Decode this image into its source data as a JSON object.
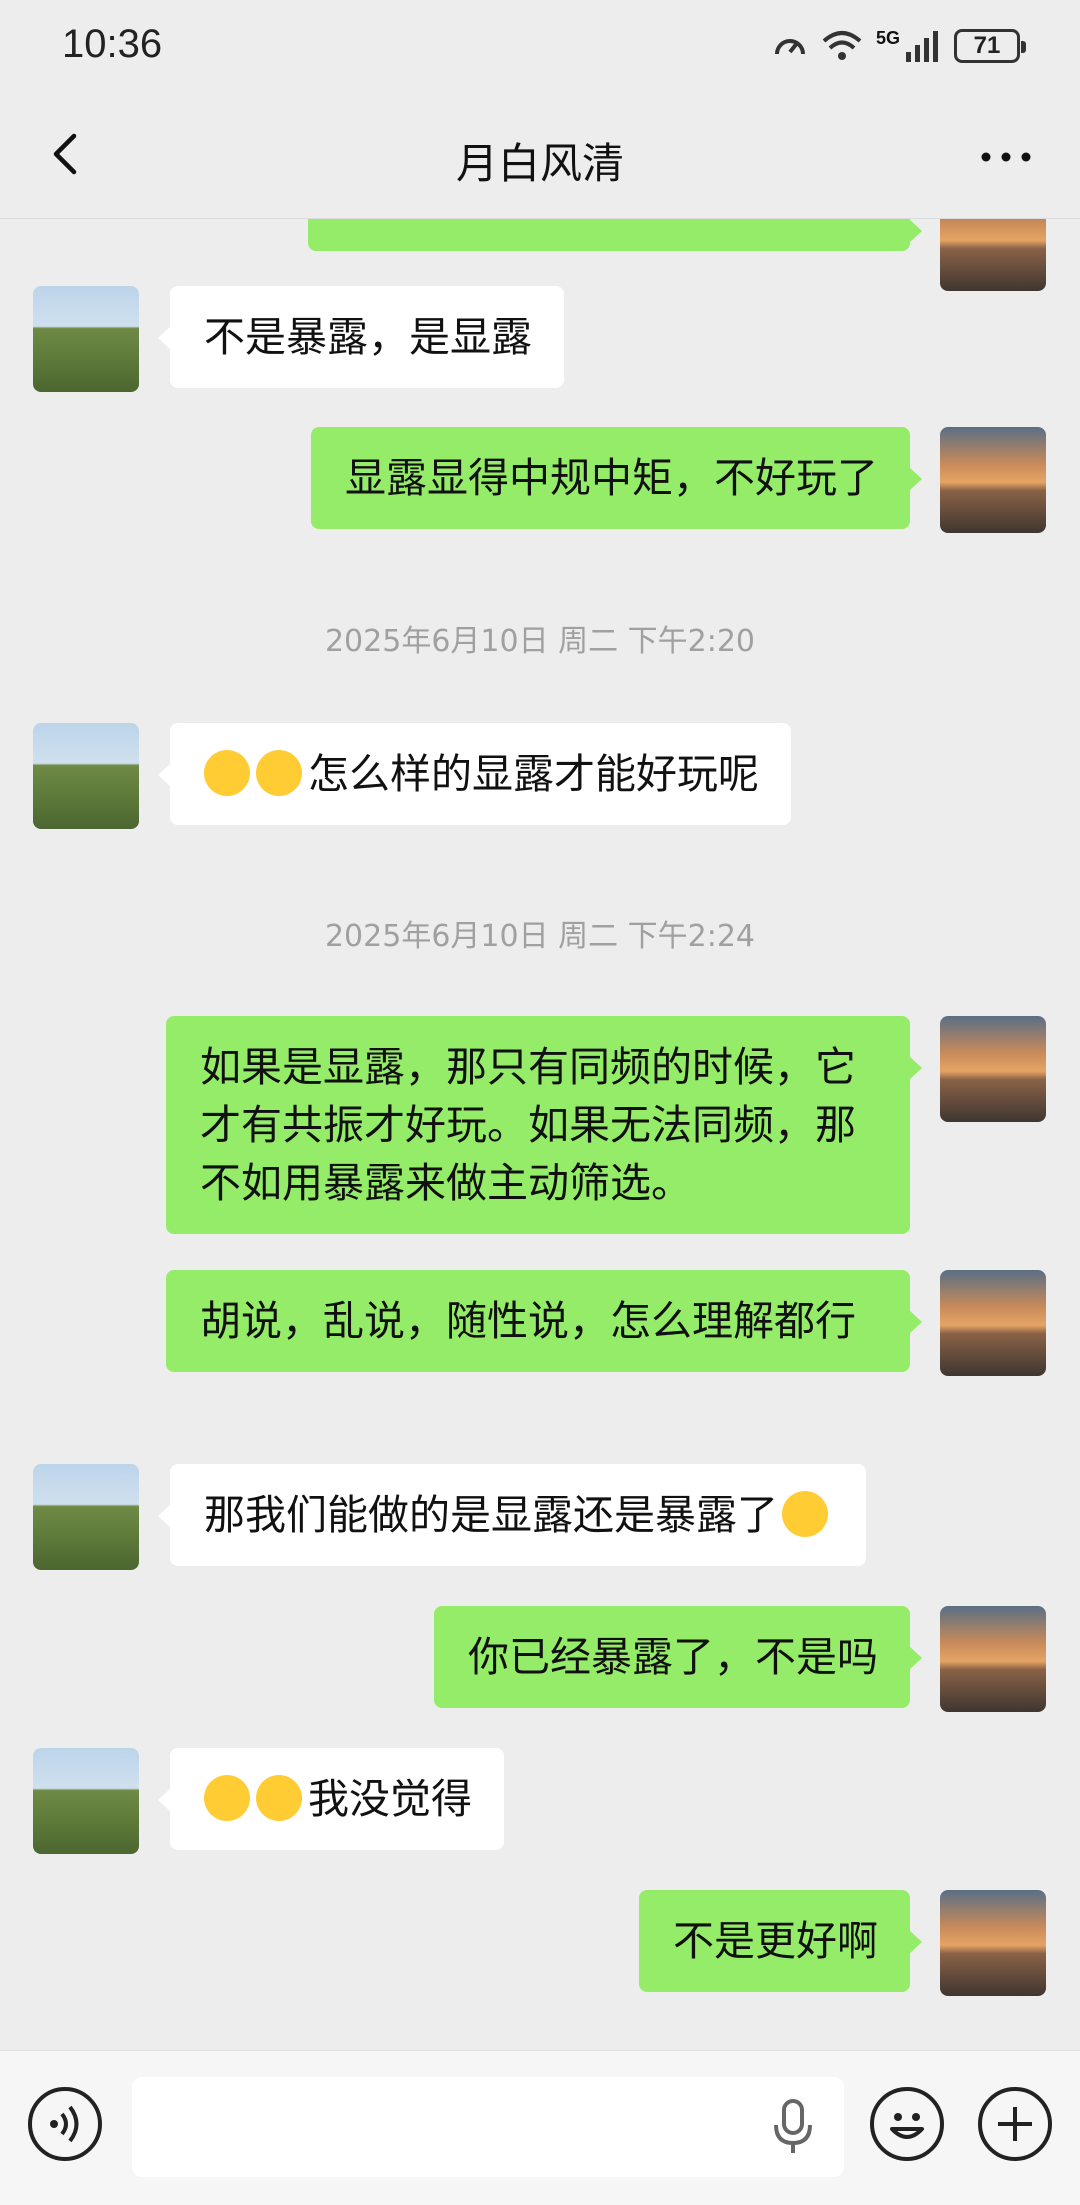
{
  "status_bar": {
    "time": "10:36",
    "network": "5G",
    "battery": "71"
  },
  "header": {
    "title": "月白风清",
    "back_icon": "chevron-left-icon",
    "more_icon": "more-dots-icon"
  },
  "messages": [
    {
      "side": "left",
      "text": "不是暴露，是显露"
    },
    {
      "side": "right",
      "text": "显露显得中规中矩，不好玩了"
    },
    {
      "type": "timestamp",
      "text": "2025年6月10日 周二 下午2:20"
    },
    {
      "side": "left",
      "emoji": [
        "facepalm-laugh-emoji",
        "facepalm-laugh-emoji"
      ],
      "text": "怎么样的显露才能好玩呢"
    },
    {
      "type": "timestamp",
      "text": "2025年6月10日 周二 下午2:24"
    },
    {
      "side": "right",
      "text": "如果是显露，那只有同频的时候，它才有共振才好玩。如果无法同频，那不如用暴露来做主动筛选。"
    },
    {
      "side": "right",
      "text": "胡说，乱说，随性说，怎么理解都行"
    },
    {
      "side": "left",
      "text": "那我们能做的是显露还是暴露了",
      "emoji_after": "smile-emoji"
    },
    {
      "side": "right",
      "text": "你已经暴露了，不是吗"
    },
    {
      "side": "left",
      "emoji": [
        "grin-emoji",
        "grin-emoji"
      ],
      "text": "我没觉得"
    },
    {
      "side": "right",
      "text": "不是更好啊"
    }
  ],
  "input_bar": {
    "placeholder": "",
    "voice_icon": "voice-icon",
    "mic_icon": "mic-icon",
    "emoji_icon": "emoji-icon",
    "plus_icon": "plus-icon"
  },
  "colors": {
    "background": "#ededed",
    "sent_bubble": "#95ec69",
    "received_bubble": "#ffffff",
    "timestamp": "#a0a0a0"
  }
}
